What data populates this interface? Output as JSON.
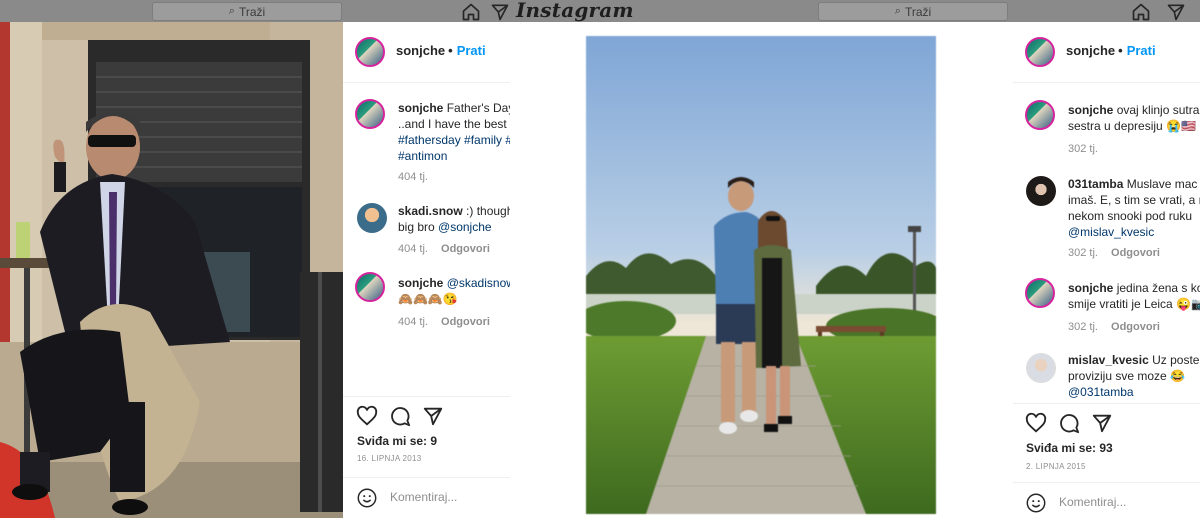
{
  "topbar": {
    "logo": "Instagram",
    "search_left_placeholder": "Traži",
    "search_right_placeholder": "Traži"
  },
  "post1": {
    "username": "sonjche",
    "follow_label": "Prati",
    "caption_user": "sonjche",
    "caption_line1": "Father's Day",
    "caption_line2": "..and I have the best",
    "caption_tags_line1": "#fathersday #family #",
    "caption_tags_line2": "#antimon",
    "caption_time": "404 tj.",
    "comments": [
      {
        "user": "skadi.snow",
        "text1": ":) though",
        "text2": "big bro ",
        "mention": "@sonjche",
        "time": "404 tj.",
        "reply": "Odgovori"
      },
      {
        "user": "sonjche",
        "mention": "@skadisnow",
        "text2": "🙈🙈🙈😘",
        "time": "404 tj.",
        "reply": "Odgovori"
      }
    ],
    "likes": "Sviđa mi se: 9",
    "date": "16. LIPNJA 2013",
    "comment_placeholder": "Komentiraj..."
  },
  "post2": {
    "username": "sonjche",
    "follow_label": "Prati",
    "caption_user": "sonjche",
    "caption_line1": "ovaj klinjo sutra",
    "caption_line2": "sestra u depresiju 😭🇺🇸",
    "caption_time": "302 tj.",
    "comments": [
      {
        "user": "031tamba",
        "text1": "Muslave mac",
        "text2": "imaš. E, s tim se vrati, a r",
        "text3": "nekom snooki pod ruku",
        "mention": "@mislav_kvesic",
        "time": "302 tj.",
        "reply": "Odgovori"
      },
      {
        "user": "sonjche",
        "text1": "jedina žena s ko",
        "text2": "smije vratiti je Leica 😜📷",
        "time": "302 tj.",
        "reply": "Odgovori"
      },
      {
        "user": "mislav_kvesic",
        "text1": "Uz posten",
        "text2": "proviziju sve moze 😂",
        "mention": "@031tamba"
      }
    ],
    "likes": "Sviđa mi se: 93",
    "date": "2. LIPNJA 2015",
    "comment_placeholder": "Komentiraj..."
  },
  "colors": {
    "link": "#00376b",
    "follow": "#0095f6",
    "meta": "#8e8e8e"
  }
}
